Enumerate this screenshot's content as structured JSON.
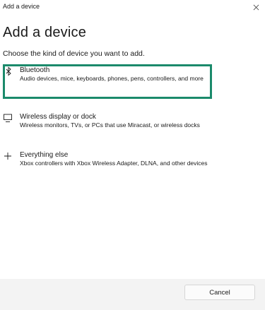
{
  "window": {
    "title": "Add a device"
  },
  "dialog": {
    "heading": "Add a device",
    "subtitle": "Choose the kind of device you want to add."
  },
  "options": [
    {
      "label": "Bluetooth",
      "description": "Audio devices, mice, keyboards, phones, pens, controllers, and more",
      "icon": "bluetooth-icon",
      "selected": true
    },
    {
      "label": "Wireless display or dock",
      "description": "Wireless monitors, TVs, or PCs that use Miracast, or wireless docks",
      "icon": "monitor-icon",
      "selected": false
    },
    {
      "label": "Everything else",
      "description": "Xbox controllers with Xbox Wireless Adapter, DLNA, and other devices",
      "icon": "plus-icon",
      "selected": false
    }
  ],
  "footer": {
    "cancel_label": "Cancel"
  },
  "colors": {
    "selection_border": "#1b8a6b",
    "footer_bg": "#f3f3f3"
  }
}
